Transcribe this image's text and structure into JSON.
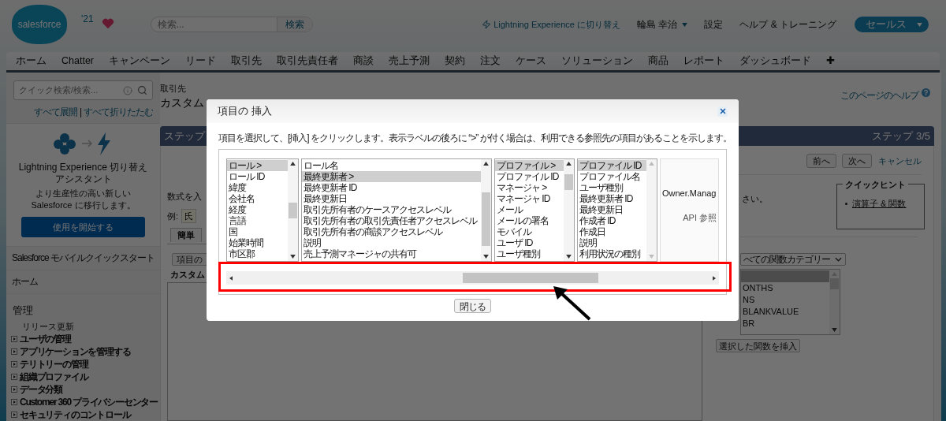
{
  "header": {
    "logo": "salesforce",
    "release_badge": "'21",
    "search": {
      "placeholder": "検索...",
      "button": "検索"
    },
    "links": [
      {
        "kind": "lightning",
        "label": "Lightning Experience に切り替え"
      },
      {
        "kind": "user",
        "label": "輪島 幸治"
      },
      {
        "kind": "plain",
        "label": "設定"
      },
      {
        "kind": "plain",
        "label": "ヘルプ & トレーニング"
      }
    ],
    "app_menu": "セールス"
  },
  "nav_tabs": [
    "ホーム",
    "Chatter",
    "キャンペーン",
    "リード",
    "取引先",
    "取引先責任者",
    "商談",
    "売上予測",
    "契約",
    "注文",
    "ケース",
    "ソリューション",
    "商品",
    "レポート",
    "ダッシュボード",
    "✚"
  ],
  "sidebar": {
    "search": {
      "placeholder": "クイック検索/検索..."
    },
    "expand_all": "すべて展開",
    "separator": "|",
    "collapse_all": "すべて折りたたむ",
    "lightning_card": {
      "title": "Lightning Experience 切り替えアシスタント",
      "text": "より生産性の高い新しい Salesforce に移行します。",
      "button": "使用を開始する"
    },
    "sections": [
      "Salesforce モバイルクイックスタート",
      "ホーム"
    ],
    "admin": {
      "title": "管理",
      "items": [
        {
          "kind": "plain",
          "label": "リリース更新"
        },
        {
          "kind": "folder",
          "label": "ユーザの管理"
        },
        {
          "kind": "folder",
          "label": "アプリケーションを管理する"
        },
        {
          "kind": "folder",
          "label": "テリトリーの管理"
        },
        {
          "kind": "folder",
          "label": "組織プロファイル"
        },
        {
          "kind": "folder",
          "label": "データ分類"
        },
        {
          "kind": "folder",
          "label": "Customer 360 プライバシーセンター"
        },
        {
          "kind": "folder",
          "label": "セキュリティのコントロール"
        }
      ]
    }
  },
  "main": {
    "breadcrumb": "取引先",
    "title": "カスタム",
    "help_link": "このページのヘルプ",
    "step_left": "ステップ",
    "step_right": "ステップ 3/5",
    "nav_buttons": [
      "前へ",
      "次へ"
    ],
    "cancel": "キャンセル",
    "intro_left": "数式を入",
    "intro_right": "さい。",
    "example_label": "例:",
    "example_value": "氏",
    "formula_tab": "簡単",
    "insert_field_button": "項目の",
    "field_label": "カスタム",
    "quick_tips": {
      "title": "クイックヒント",
      "links": [
        "演算子 & 関数"
      ]
    },
    "function_category": "べての関数カテゴリー",
    "functions": [
      {
        "selected": true
      },
      {
        "label": "ONTHS",
        "selected": false
      },
      {
        "label": "NS",
        "selected": false
      },
      {
        "label": "BLANKVALUE",
        "selected": false
      },
      {
        "label": "BR",
        "selected": false
      }
    ],
    "insert_function_button": "選択した関数を挿入"
  },
  "dialog": {
    "title": "項目の 挿入",
    "instruction": "項目を選択して、[挿入] をクリックします。表示ラベルの後ろに “>” が付く場合は、利用できる参照先の項目があることを示します。",
    "columns": [
      {
        "items": [
          {
            "label": "ロール >",
            "selected": true
          },
          {
            "label": "ロール ID",
            "selected": false
          },
          {
            "label": "緯度",
            "selected": false
          },
          {
            "label": "会社名",
            "selected": false
          },
          {
            "label": "経度",
            "selected": false
          },
          {
            "label": "言語",
            "selected": false
          },
          {
            "label": "国",
            "selected": false
          },
          {
            "label": "始業時間",
            "selected": false
          },
          {
            "label": "市区郡",
            "selected": false
          }
        ]
      },
      {
        "items": [
          {
            "label": "ロール名",
            "selected": false
          },
          {
            "label": "最終更新者 >",
            "selected": true
          },
          {
            "label": "最終更新者 ID",
            "selected": false
          },
          {
            "label": "最終更新日",
            "selected": false
          },
          {
            "label": "取引先所有者のケースアクセスレベル",
            "selected": false
          },
          {
            "label": "取引先所有者の取引先責任者アクセスレベル",
            "selected": false
          },
          {
            "label": "取引先所有者の商談アクセスレベル",
            "selected": false
          },
          {
            "label": "説明",
            "selected": false
          },
          {
            "label": "売上予測マネージャの共有可",
            "selected": false
          }
        ]
      },
      {
        "items": [
          {
            "label": "プロファイル >",
            "selected": true
          },
          {
            "label": "プロファイル ID",
            "selected": false
          },
          {
            "label": "マネージャ >",
            "selected": false
          },
          {
            "label": "マネージャ ID",
            "selected": false
          },
          {
            "label": "メール",
            "selected": false
          },
          {
            "label": "メールの署名",
            "selected": false
          },
          {
            "label": "モバイル",
            "selected": false
          },
          {
            "label": "ユーザ ID",
            "selected": false
          },
          {
            "label": "ユーザ種別",
            "selected": false
          }
        ]
      },
      {
        "items": [
          {
            "label": "プロファイル ID",
            "selected": true
          },
          {
            "label": "プロファイル名",
            "selected": false
          },
          {
            "label": "ユーザ種別",
            "selected": false
          },
          {
            "label": "最終更新者 ID",
            "selected": false
          },
          {
            "label": "最終更新日",
            "selected": false
          },
          {
            "label": "作成者 ID",
            "selected": false
          },
          {
            "label": "作成日",
            "selected": false
          },
          {
            "label": "説明",
            "selected": false
          },
          {
            "label": "利用状況の種別",
            "selected": false
          }
        ]
      }
    ],
    "detail": {
      "field": "Owner.Manag",
      "caption": "API 参照"
    },
    "close_button": "閉じる"
  }
}
